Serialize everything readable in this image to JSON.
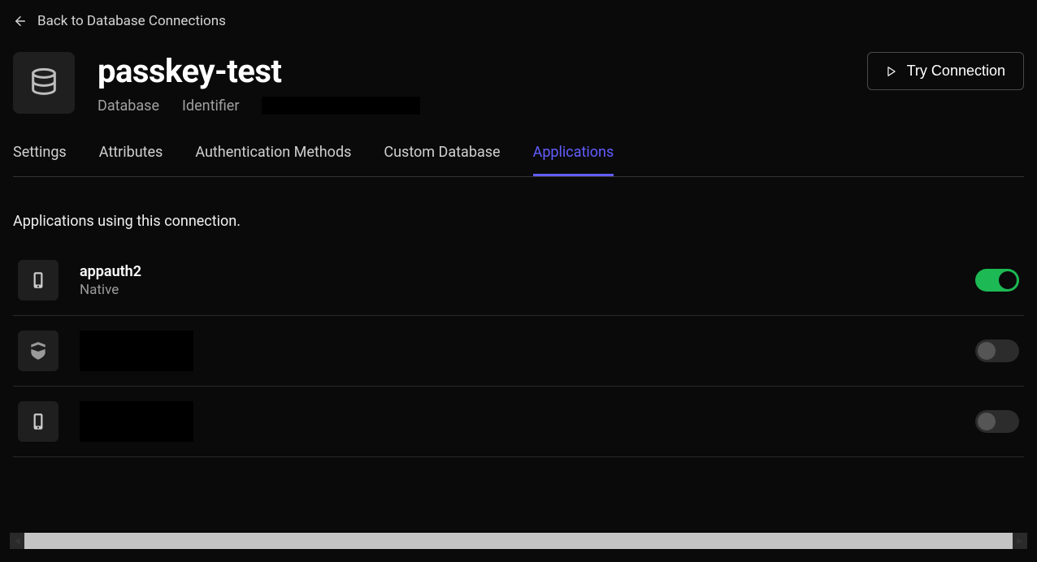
{
  "back_link": "Back to Database Connections",
  "header": {
    "title": "passkey-test",
    "type_label": "Database",
    "identifier_label": "Identifier",
    "identifier_value": ""
  },
  "try_connection_label": "Try Connection",
  "tabs": [
    {
      "label": "Settings",
      "active": false
    },
    {
      "label": "Attributes",
      "active": false
    },
    {
      "label": "Authentication Methods",
      "active": false
    },
    {
      "label": "Custom Database",
      "active": false
    },
    {
      "label": "Applications",
      "active": true
    }
  ],
  "section_description": "Applications using this connection.",
  "applications": [
    {
      "name": "appauth2",
      "type": "Native",
      "icon": "mobile",
      "enabled": true,
      "redacted": false
    },
    {
      "name": "",
      "type": "",
      "icon": "shield",
      "enabled": false,
      "redacted": true
    },
    {
      "name": "",
      "type": "",
      "icon": "mobile",
      "enabled": false,
      "redacted": true
    }
  ]
}
